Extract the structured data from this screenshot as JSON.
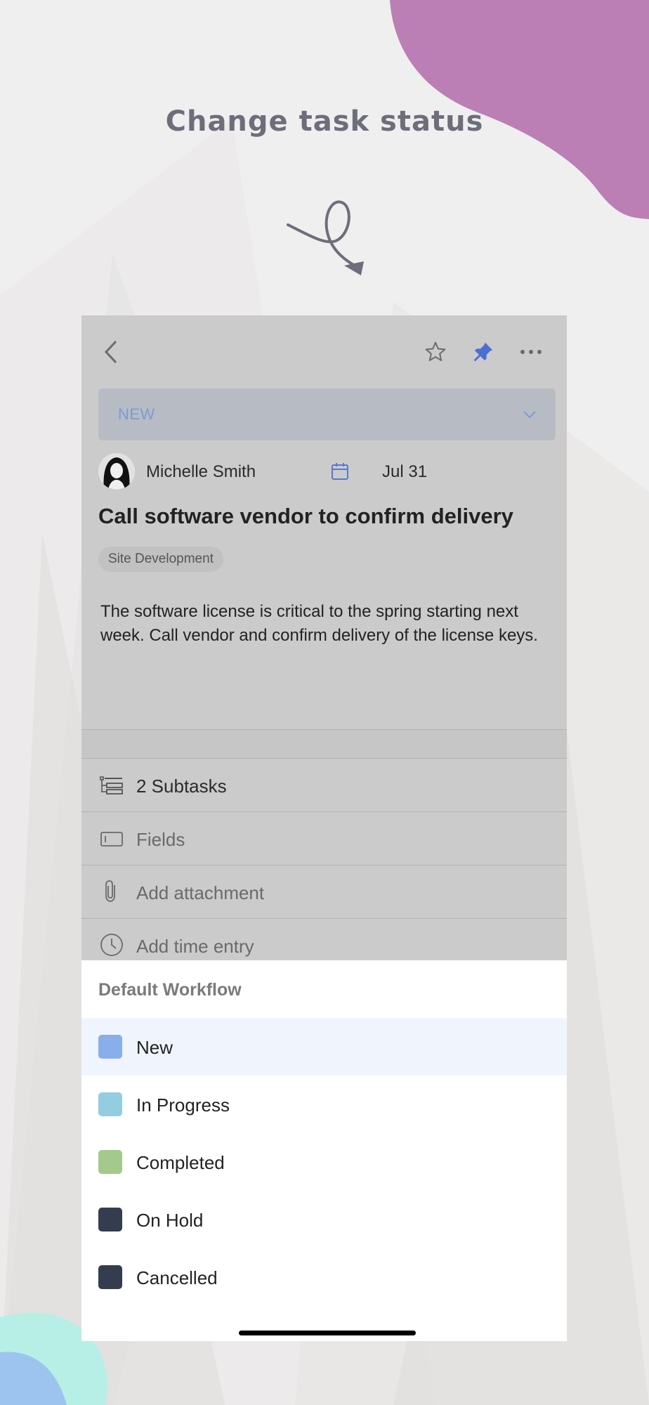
{
  "headline": "Change task status",
  "toolbar": {
    "back_icon": "chevron-left-icon",
    "star_icon": "star-icon",
    "pin_icon": "pin-icon",
    "more_icon": "more-dots-icon",
    "pin_color": "#4a6fd1"
  },
  "status": {
    "label": "NEW",
    "color": "#7c9bd3"
  },
  "task": {
    "assignee": "Michelle Smith",
    "due_date": "Jul 31",
    "title": "Call software vendor to confirm delivery",
    "tag": "Site Development",
    "description": "The software license is critical to the spring starting next week. Call vendor and confirm delivery of the license keys."
  },
  "rows": [
    {
      "label": "2 Subtasks",
      "icon": "subtasks-icon"
    },
    {
      "label": "Fields",
      "icon": "fields-icon"
    },
    {
      "label": "Add attachment",
      "icon": "paperclip-icon"
    },
    {
      "label": "Add time entry",
      "icon": "clock-icon"
    }
  ],
  "workflow": {
    "title": "Default Workflow",
    "options": [
      {
        "label": "New",
        "color": "#8aaeea",
        "selected": true
      },
      {
        "label": "In Progress",
        "color": "#94cde0",
        "selected": false
      },
      {
        "label": "Completed",
        "color": "#a3c98c",
        "selected": false
      },
      {
        "label": "On Hold",
        "color": "#343d4f",
        "selected": false
      },
      {
        "label": "Cancelled",
        "color": "#343d4f",
        "selected": false
      }
    ]
  }
}
